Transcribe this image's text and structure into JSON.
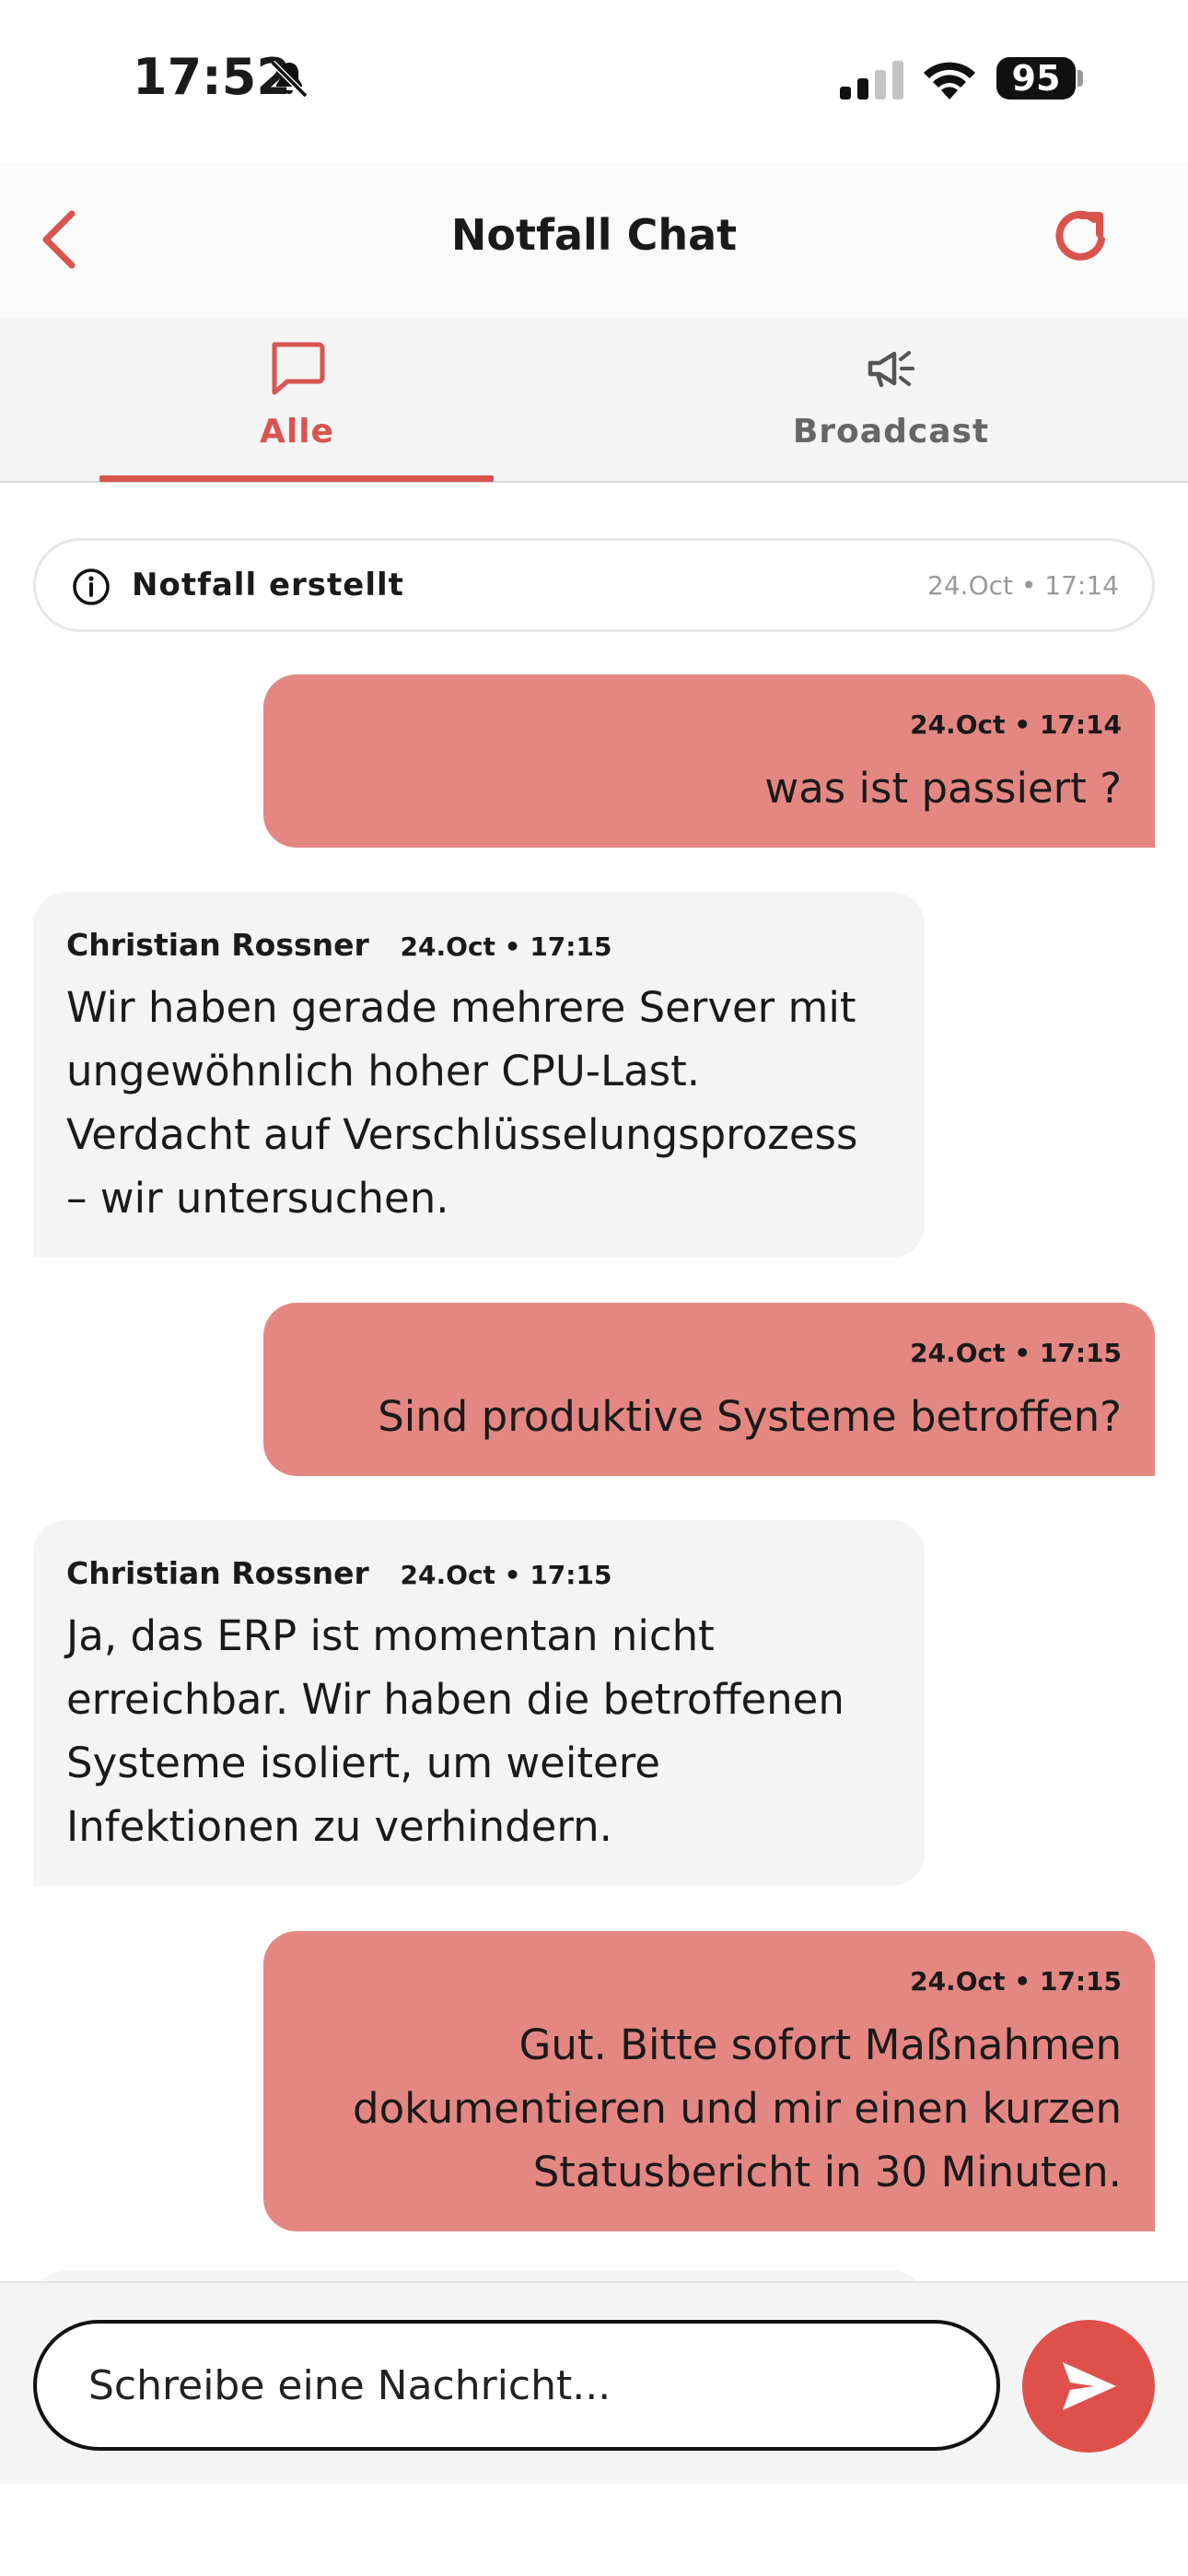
{
  "status_bar": {
    "time": "17:52",
    "battery": "95"
  },
  "header": {
    "title": "Notfall Chat"
  },
  "tabs": [
    {
      "label": "Alle",
      "icon": "chat-bubble-icon",
      "active": true
    },
    {
      "label": "Broadcast",
      "icon": "megaphone-icon",
      "active": false
    }
  ],
  "system_message": {
    "text": "Notfall erstellt",
    "time": "24.Oct • 17:14"
  },
  "messages": [
    {
      "direction": "out",
      "time": "24.Oct • 17:14",
      "text": "was ist passiert ?"
    },
    {
      "direction": "in",
      "sender": "Christian Rossner",
      "time": "24.Oct • 17:15",
      "text": "Wir haben gerade mehrere Server mit ungewöhnlich hoher CPU-Last. Verdacht auf Verschlüsselungsprozess – wir untersuchen."
    },
    {
      "direction": "out",
      "time": "24.Oct • 17:15",
      "text": "Sind produktive Systeme betroffen?"
    },
    {
      "direction": "in",
      "sender": "Christian Rossner",
      "time": "24.Oct • 17:15",
      "text": "Ja, das ERP ist momentan nicht erreichbar. Wir haben die betroffenen Systeme isoliert, um weitere Infektionen zu verhindern."
    },
    {
      "direction": "out",
      "time": "24.Oct • 17:15",
      "text": "Gut. Bitte sofort Maßnahmen dokumentieren und mir einen kurzen Statusbericht in 30 Minuten."
    }
  ],
  "composer": {
    "placeholder": "Schreibe eine Nachricht..."
  },
  "colors": {
    "accent": "#d9544f",
    "outgoing_bubble": "#e48782",
    "incoming_bubble": "#f4f4f4",
    "send_button": "#e0504b"
  }
}
